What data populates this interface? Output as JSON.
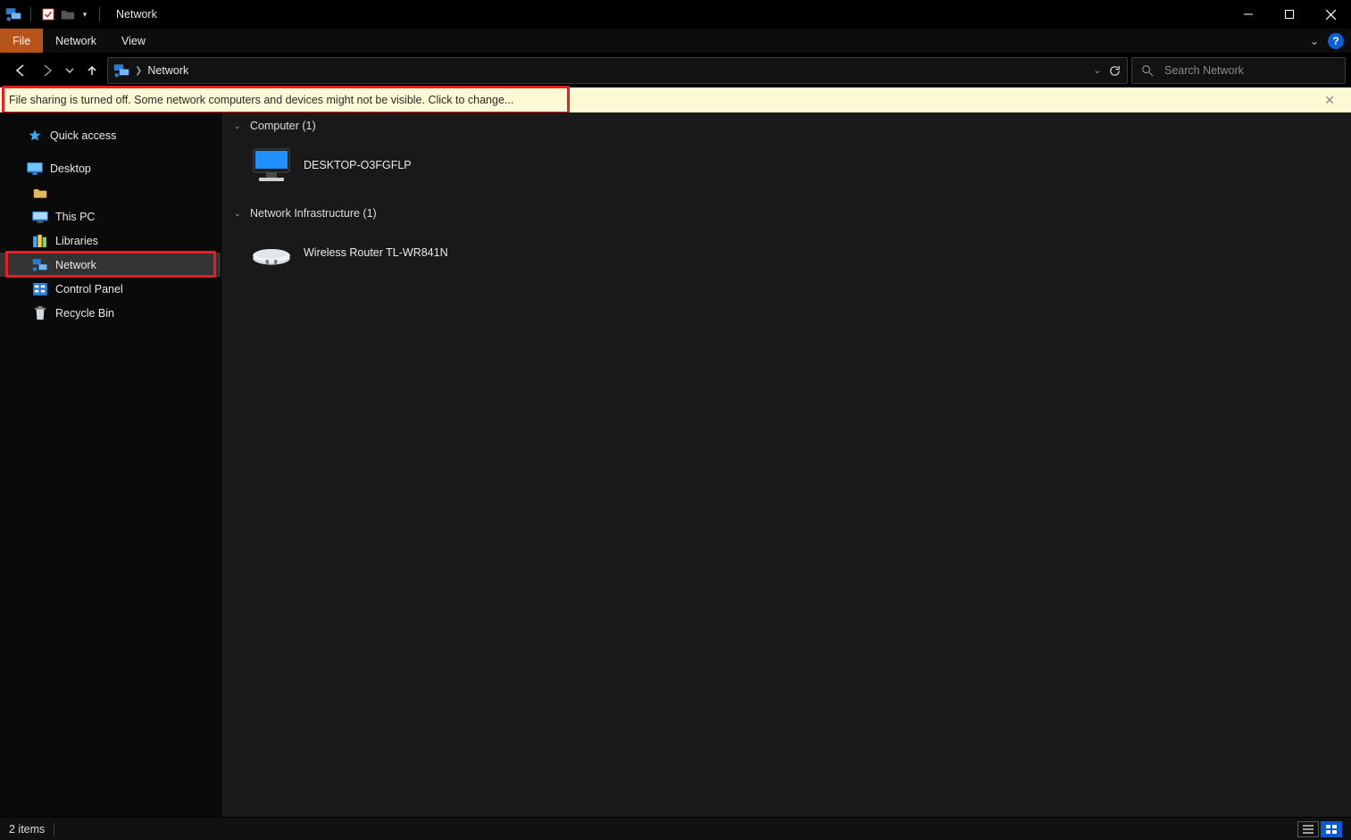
{
  "window": {
    "title": "Network"
  },
  "ribbon": {
    "file": "File",
    "tabs": [
      "Network",
      "View"
    ]
  },
  "nav": {
    "breadcrumb": "Network"
  },
  "search": {
    "placeholder": "Search Network"
  },
  "infobar": {
    "text": "File sharing is turned off. Some network computers and devices might not be visible. Click to change..."
  },
  "sidebar": {
    "quick_access": "Quick access",
    "desktop": "Desktop",
    "user_placeholder": "",
    "this_pc": "This PC",
    "libraries": "Libraries",
    "network": "Network",
    "control_panel": "Control Panel",
    "recycle_bin": "Recycle Bin"
  },
  "content": {
    "groups": [
      {
        "title": "Computer (1)",
        "items": [
          {
            "label": "DESKTOP-O3FGFLP",
            "kind": "computer"
          }
        ]
      },
      {
        "title": "Network Infrastructure (1)",
        "items": [
          {
            "label": "Wireless Router TL-WR841N",
            "kind": "router"
          }
        ]
      }
    ]
  },
  "status": {
    "items": "2 items"
  }
}
